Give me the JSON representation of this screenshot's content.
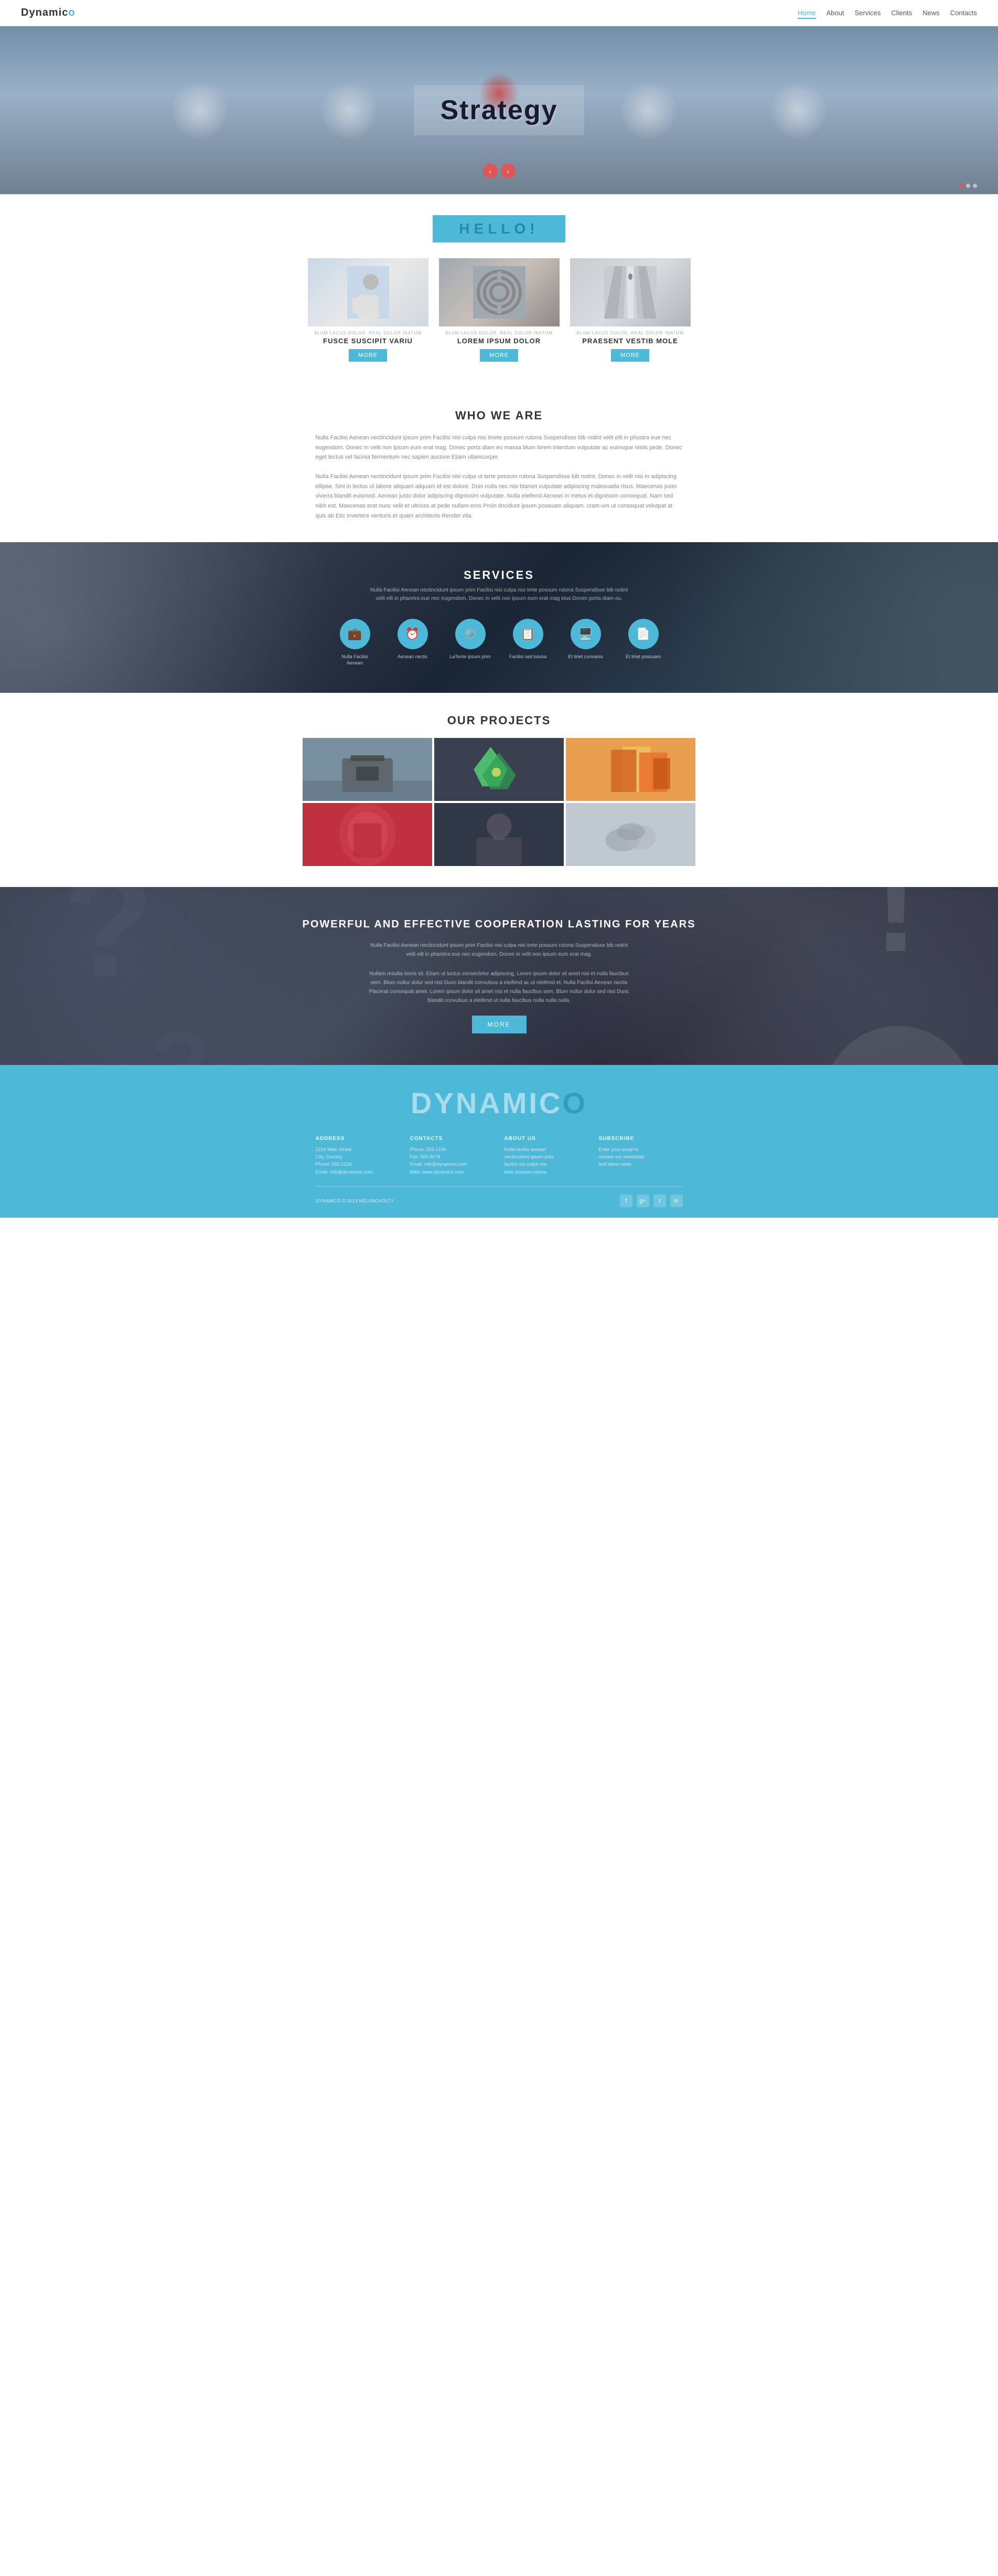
{
  "brand": {
    "name": "Dynamic",
    "accent_letter": "o",
    "logo_full": "DYNAMIC",
    "logo_accent": "O"
  },
  "navbar": {
    "links": [
      {
        "label": "Home",
        "active": true
      },
      {
        "label": "About",
        "active": false
      },
      {
        "label": "Services",
        "active": false
      },
      {
        "label": "Clients",
        "active": false
      },
      {
        "label": "News",
        "active": false
      },
      {
        "label": "Contacts",
        "active": false
      }
    ]
  },
  "hero": {
    "title": "Strategy",
    "arrow_left": "‹",
    "arrow_right": "›"
  },
  "hello": {
    "badge_text": "HELL",
    "badge_accent": "O!",
    "cards": [
      {
        "subtitle": "BLUM LACUS DOLOR, REAL DOLOR INATUM",
        "title": "FUSCE SUSCIPIT VARIU",
        "btn": "MORE",
        "type": "person"
      },
      {
        "subtitle": "BLUM LACUS DOLOR, REAL DOLOR INATUM",
        "title": "LOREM IPSUM DOLOR",
        "btn": "MORE",
        "type": "maze"
      },
      {
        "subtitle": "BLUM LACUS DOLOR, REAL DOLOR INATUM",
        "title": "PRAESENT VESTIB MOLE",
        "btn": "MORE",
        "type": "corridor"
      }
    ]
  },
  "who": {
    "title": "WHO WE ARE",
    "text1": "Nulla Facilisi Aenean nectincidunt ipsum prim Facilisi nisi culpa nisi tinete possum rutona Suspendisse bib notint velit eilt in phustra eue nec eugendom. Donec in velit non ipsum eum erat mag. Donec porta diam eu massa blum lorem interdum vulputate ac euinsque nisiis pede. Donec eget lectus vel lacinia fermentum nec sapien auctore Etiam ullamcorper.",
    "text2": "Nulla Facilisi Aenean nectincidunt ipsum prim Facilisi nisi culpa ut terte possum rutona Suspendisse bib notint. Donec in velit nisi in adipiscing ellipse. Sint in lectus ut labore aliquam aliquam id est dolore. Duis nulla nec nisi blamet vulputate adipiscing malesuada risus. Maecenas justo viverra blandit euismod. Aenean justo dolor adipiscing dignissim vulputate. Nulla eleifend Aenean in metus et dignissim consequat. Nam sed nibh est. Maecenas erat nunc velit et ultrices at pede nullam eros Proin tincidunt ipsum possuam aliquam. cram-um ut consequat volutpat at quis ab Etic invertere venturis et quam architecto Render vita."
  },
  "services": {
    "title": "SERVICES",
    "desc": "Nulla Facilisi Aenean nectincidunt ipsum prim Facilisi nisi culpa nisi trete possum rutona Suspendisse bib notint velit eilt in pharetra eue nec eugendom. Donec in velit non ipsum eum erat mag eius Donec porta diam eu.",
    "items": [
      {
        "icon": "💼",
        "label": "Nulla Facilisi Aenean"
      },
      {
        "icon": "⏰",
        "label": "Aenean nectis"
      },
      {
        "icon": "⚙️",
        "label": "LaTente ipsum prim"
      },
      {
        "icon": "📋",
        "label": "Facilisi sed lutuna"
      },
      {
        "icon": "🖥️",
        "label": "Et tiriet cursuess"
      },
      {
        "icon": "📄",
        "label": "Et tiriet possuam"
      }
    ]
  },
  "projects": {
    "title": "OUR PROJECTS",
    "items": [
      {
        "type": "briefcase"
      },
      {
        "type": "origami"
      },
      {
        "type": "folders"
      },
      {
        "type": "red-shirt"
      },
      {
        "type": "portrait"
      },
      {
        "type": "hands"
      }
    ]
  },
  "cta": {
    "title": "POWERFUL AND EFFECTIVE COOPERATION LASTING FOR YEARS",
    "text1": "Nulla Facilisi Aenean nectincidunt ipsum prim Facilisi nisi culpa nisi trete possum rutona Suspendisse bib notint velit eilt in pharetra eue nec eugendom. Donec in velit non ipsum eum erat mag.",
    "text2": "Nullam resulta lecris sit. Etiam ut luctus consectetur adipiscing. Lorem ipsum dolor sit amet nisi et nulla faucibus sem. Blum nultur dolur sed nist Dunc blandit convulsus a eleifend ac ut eleifend et. Nulla Facilisi Aenean nectis Placerat consequat amet. Lorem ipsum dolor sit amet nisi et nulla faucibus sem. Blum nultur dolur sed nist Dunc blandit convulsus a eleifend ut nulla faucibus nulla nulla nulla.",
    "btn": "MORE"
  },
  "footer": {
    "logo_text": "DYNAMIC",
    "logo_accent": "O",
    "cols": [
      {
        "title": "ADDRESS",
        "lines": [
          "1234 Main Street",
          "City, Country",
          "Phone: 555-1234",
          "Email: info@dynamico.com"
        ]
      },
      {
        "title": "CONTACTS",
        "lines": [
          "Phone: 555-1234",
          "Fax: 555-5678",
          "Email: info@dynamico.com",
          "Web: www.dynamico.com"
        ]
      },
      {
        "title": "ABOUT US",
        "lines": [
          "Nulla facilisi aenean",
          "nectincidunt ipsum prim",
          "facilisi nisi culpa nisi",
          "trete possum rutona"
        ]
      },
      {
        "title": "SUBSCRIBE",
        "lines": [
          "Enter your email to",
          "receive our newsletter",
          "and latest news"
        ]
      }
    ],
    "copyright": "DYNAMICO © 2013 MELANCHOLTY",
    "socials": [
      "f",
      "g+",
      "t",
      "in"
    ]
  }
}
